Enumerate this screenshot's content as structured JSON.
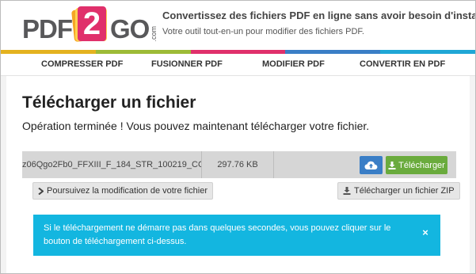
{
  "header": {
    "logo": {
      "part1": "PDF",
      "part2": "2",
      "part3": "GO",
      "suffix": ".com"
    },
    "tagline": "Convertissez des fichiers PDF en ligne sans avoir besoin d'installer un",
    "subtagline": "Votre outil tout-en-un pour modifier des fichiers PDF."
  },
  "colors": {
    "bar": [
      "#e4b21f",
      "#9dbb37",
      "#e0306b",
      "#3a7ec6",
      "#1fa7d6"
    ],
    "download_green": "#6aab3d",
    "cloud_blue": "#3a7ec6",
    "alert_blue": "#13b6e0"
  },
  "nav": {
    "items": [
      "COMPRESSER PDF",
      "FUSIONNER PDF",
      "MODIFIER PDF",
      "CONVERTIR EN PDF"
    ]
  },
  "main": {
    "title": "Télécharger un fichier",
    "message": "Opération terminée ! Vous pouvez maintenant télécharger votre fichier.",
    "file": {
      "name": "z06Qgo2Fb0_FFXIII_F_184_STR_100219_CO...",
      "size": "297.76 KB"
    },
    "download_label": "Télécharger",
    "continue_label": "Poursuivez la modification de votre fichier",
    "zip_label": "Télécharger un fichier ZIP",
    "alert_text": "Si le téléchargement ne démarre pas dans quelques secondes, vous pouvez cliquer sur le bouton de téléchargement ci-dessus.",
    "alert_close": "×"
  },
  "icons": {
    "cloud": "cloud-upload-icon",
    "download": "download-icon",
    "chevron": "chevron-right-icon",
    "close": "close-icon"
  }
}
